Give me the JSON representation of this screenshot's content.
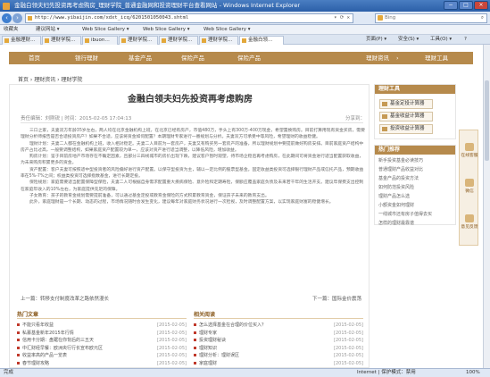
{
  "window": {
    "title": "金融白领夫妇先投资再考虑购房_理财学院_普通金融网和投资理财平台查看网站 - Windows Internet Explorer",
    "buttons": [
      "−",
      "□",
      "×"
    ]
  },
  "address_bar": {
    "url": "http://www.yibaijin.com/xdxt_icq/6201501050043.shtml",
    "tools": "▾ ⟳ ✕",
    "search_placeholder": "Bing"
  },
  "favorites_bar": {
    "favorites_label": "收藏夹",
    "items": [
      "建议网站 ▾",
      "Web Slice Gallery ▾",
      "Web Slice Gallery ▾",
      "Web Slice Gallery ▾"
    ]
  },
  "tabs": {
    "items": [
      "金融理财…",
      "理财学院…",
      "ibuon…",
      "理财学院…",
      "理财学院…",
      "理财学院…",
      "金融白领…"
    ],
    "commands": [
      "页面(P) ▾",
      "安全(S) ▾",
      "工具(O) ▾",
      "?"
    ]
  },
  "site_nav": {
    "items": [
      "首页",
      "银行理财",
      "基金产品",
      "保险产品",
      "保险产品"
    ],
    "right_items": [
      "理财资讯",
      "理财工具"
    ],
    "separator": "›"
  },
  "breadcrumb": "首页 › 理财资讯 › 理财学院",
  "article": {
    "title": "金融白领夫妇先投资再考虑购房",
    "meta": "责任编辑：刘刚锐  |  时间：2015-02-05 17:04:13",
    "share_label": "分享到：",
    "paragraphs": [
      "三口之家，夫妻双方年龄35岁左右，两人均在北京金融机构上班，在北京已经有房产，市值480万，手头上有300万-400万现金，希望置换购房。目前打算用现有资金买房，需要理财分析师报告是否合适投资房产？如果不合适，应该将资金如何配置？本期理财专家进行一番规划与分析。夫妻双方可承受中等风险，希望理财的收益稳健。",
      "理财计划：夫妻二人都在金融机构上班，收入相对稳定。夫妻二人目前为一套房产，夫妻又有购买另一套房产的准备，所以理财规划中要提前做好购房安排。目前家庭资产结构中房产占比过高，一般要调整结构，如果家庭资产配置较为单一，应该对资产进行适当调整，以降低风险，增加收益。",
      "购房计划：鉴于目前房地产市场存在不确定因素，且部分三四线城市的房价出现下跌，建议客户暂时观望，待市场企稳后再考虑购房，在此期间可将资金进行适当配置获取收益，为未来购房积累更多的资金。",
      "资产配置：客户夫妻可按照适中型投资者的风险偏好进行资产配置。以保守型投资为主，辅以一定比例的股票型基金。固定收益类投资可选择银行理财产品或信托产品，预期收益率在5%-7%之间；权益类投资可选择指数基金，进行长期定投。",
      "保险规划：家庭需要适当配置保障型保险，夫妻二人可根据自身需求配置重大疾病保险、意外险和定期寿险，保额应覆盖家庭负债及未来若干年的生活开支。建议年保费支出控制在家庭年收入的10%左右，为家庭提供充足的保障。",
      "子女教育：孩子的教育金规划需要提前准备，可以通过基金定投或教育金保险的方式积累教育资金，保证孩子未来的教育支出。",
      "此外，家庭理财是一个长期、动态的过程，市场情况随时会发生变化，建议每年对家庭财务状况进行一次检视，及时调整配置方案，以实现家庭财富的稳健增长。"
    ]
  },
  "pager": {
    "prev": "上一篇：转移支付制度改革之路依然漫长",
    "next": "下一篇：国际金价震荡"
  },
  "recommended": {
    "title": "热门文章",
    "items": [
      {
        "text": "不能只看年收益",
        "date": "[2015-02-05]"
      },
      {
        "text": "私募基金新年2015年行情",
        "date": "[2015-02-05]"
      },
      {
        "text": "信用卡分期：盘踞在你背后的三五天",
        "date": "[2015-02-05]"
      },
      {
        "text": "中汇财经早餐：欧洲央行行长宣布欧元区",
        "date": "[2015-02-05]"
      },
      {
        "text": "收益率高的产品一览表",
        "date": "[2015-02-05]"
      },
      {
        "text": "春节理财攻略",
        "date": "[2015-02-05]"
      }
    ]
  },
  "related": {
    "title": "相关阅读",
    "items": [
      {
        "text": "怎么选择基金在合理的价位买入？",
        "date": "[2015-02-05]"
      },
      {
        "text": "理财专家",
        "date": "[2015-02-05]"
      },
      {
        "text": "投资理财秘诀",
        "date": "[2015-02-05]"
      },
      {
        "text": "理财知识",
        "date": "[2015-02-05]"
      },
      {
        "text": "理财分析：理财误区",
        "date": "[2015-02-05]"
      },
      {
        "text": "家庭理财",
        "date": "[2015-02-05]"
      }
    ]
  },
  "sidebar": {
    "tools_title": "理财工具",
    "tools": [
      "基金定投计算器",
      "基金收益计算器",
      "投资收益计算器"
    ],
    "hot_title": "热门推荐",
    "hot_items": [
      "新手投资基金必读技巧",
      "普通理财产品收益对比",
      "基金产品的投资方法",
      "如何防范投资风险",
      "理财产品怎么选",
      "小额资金如何理财",
      "一线城市还有房子值得去买",
      "怎样的理财最靠谱"
    ]
  },
  "float_toolbar": [
    "在线客服",
    "微信",
    "意见反馈"
  ],
  "status_bar": {
    "left": "完成",
    "zone": "Internet | 保护模式：禁用",
    "zoom": "100%"
  }
}
